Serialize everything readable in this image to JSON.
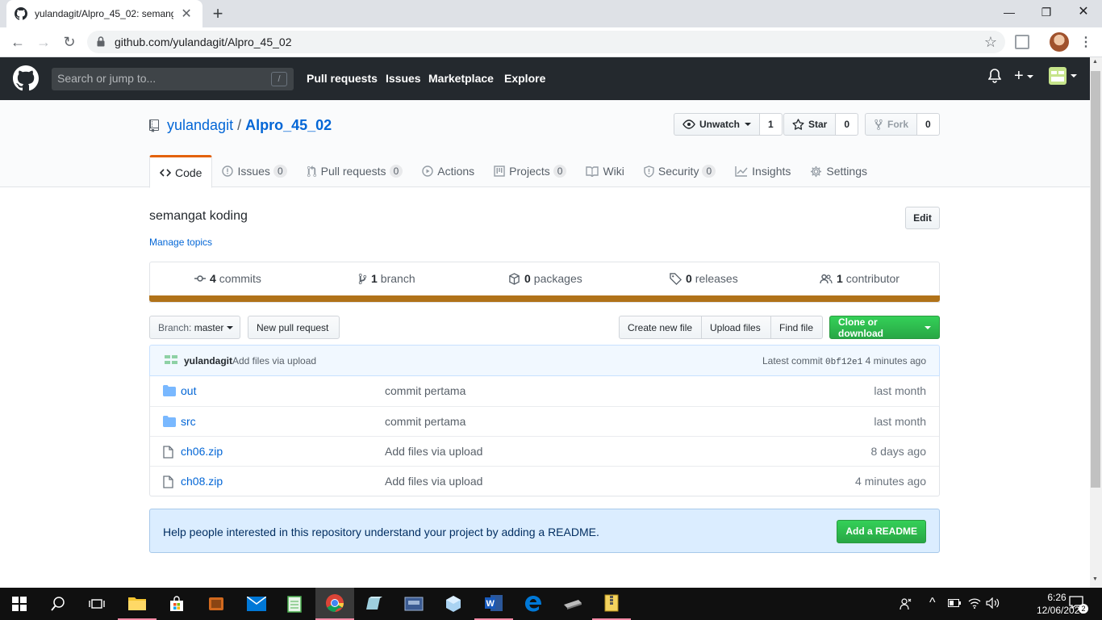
{
  "browser": {
    "tab_title": "yulandagit/Alpro_45_02: semangat koding",
    "url": "github.com/yulandagit/Alpro_45_02"
  },
  "github": {
    "search_placeholder": "Search or jump to...",
    "search_hint": "/",
    "nav": [
      "Pull requests",
      "Issues",
      "Marketplace",
      "Explore"
    ]
  },
  "repo": {
    "owner": "yulandagit",
    "separator": "/",
    "name": "Alpro_45_02",
    "watch_label": "Unwatch",
    "watch_count": "1",
    "star_label": "Star",
    "star_count": "0",
    "fork_label": "Fork",
    "fork_count": "0",
    "tabs": [
      {
        "label": "Code"
      },
      {
        "label": "Issues",
        "count": "0"
      },
      {
        "label": "Pull requests",
        "count": "0"
      },
      {
        "label": "Actions"
      },
      {
        "label": "Projects",
        "count": "0"
      },
      {
        "label": "Wiki"
      },
      {
        "label": "Security",
        "count": "0"
      },
      {
        "label": "Insights"
      },
      {
        "label": "Settings"
      }
    ],
    "description": "semangat koding",
    "manage_topics": "Manage topics",
    "edit_label": "Edit",
    "summary": {
      "commits_count": "4",
      "commits_label": "commits",
      "branch_count": "1",
      "branch_label": "branch",
      "packages_count": "0",
      "packages_label": "packages",
      "releases_count": "0",
      "releases_label": "releases",
      "contributor_count": "1",
      "contributor_label": "contributor"
    },
    "language_color": "#b07219",
    "branch_prefix": "Branch:",
    "branch_name": "master",
    "new_pr": "New pull request",
    "create_file": "Create new file",
    "upload_files": "Upload files",
    "find_file": "Find file",
    "clone": "Clone or download",
    "latest_commit": {
      "user": "yulandagit",
      "message": "Add files via upload",
      "prefix": "Latest commit",
      "sha": "0bf12e1",
      "age": "4 minutes ago"
    },
    "files": [
      {
        "type": "dir",
        "name": "out",
        "message": "commit pertama",
        "age": "last month"
      },
      {
        "type": "dir",
        "name": "src",
        "message": "commit pertama",
        "age": "last month"
      },
      {
        "type": "file",
        "name": "ch06.zip",
        "message": "Add files via upload",
        "age": "8 days ago"
      },
      {
        "type": "file",
        "name": "ch08.zip",
        "message": "Add files via upload",
        "age": "4 minutes ago"
      }
    ],
    "readme_prompt": "Help people interested in this repository understand your project by adding a README.",
    "readme_button": "Add a README"
  },
  "taskbar": {
    "time": "6:26",
    "date": "12/06/2020",
    "notifications": "2"
  }
}
